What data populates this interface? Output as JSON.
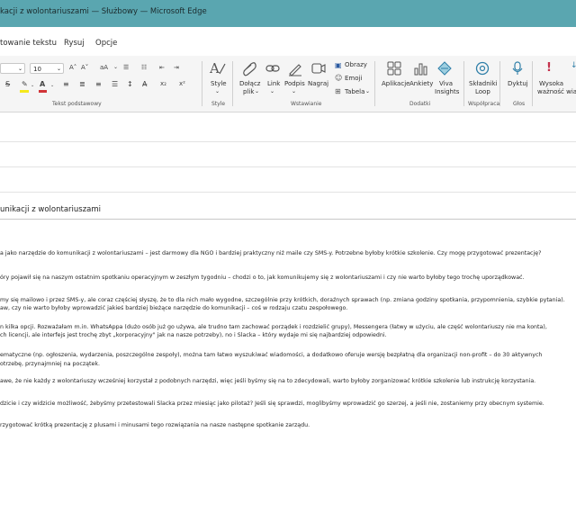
{
  "window": {
    "title": "kacji z wolontariuszami — Służbowy — Microsoft Edge"
  },
  "menu": {
    "items": [
      "towanie tekstu",
      "Rysuj",
      "Opcje"
    ]
  },
  "ribbon": {
    "font_size": "10",
    "styles_label": "Style",
    "attach_label_1": "Dołącz",
    "attach_label_2": "plik",
    "link_label": "Link",
    "signature_label": "Podpis",
    "record_label": "Nagraj",
    "images_label": "Obrazy",
    "emoji_label": "Emoji",
    "table_label": "Tabela",
    "apps_label": "Aplikacje",
    "polls_label": "Ankiety",
    "viva_label_1": "Viva",
    "viva_label_2": "Insights",
    "loop_label_1": "Składniki",
    "loop_label_2": "Loop",
    "dictate_label": "Dyktuj",
    "priority_label_1": "Wysoka",
    "priority_label_2": "ważność wia",
    "group_basic_text": "Tekst podstawowy",
    "group_style": "Style",
    "group_insert": "Wstawianie",
    "group_addins": "Dodatki",
    "group_collab": "Współpraca",
    "group_voice": "Głos",
    "accent": "#5aa6b0"
  },
  "message": {
    "subject": "unikacji z wolontariuszami",
    "paragraphs": [
      "a jako narzędzie do komunikacji z wolontariuszami – jest darmowy dla NGO i bardziej praktyczny niż maile czy SMS-y. Potrzebne byłoby krótkie szkolenie. Czy mogę przygotować prezentację?",
      "óry pojawił się na naszym ostatnim spotkaniu operacyjnym w zeszłym tygodniu – chodzi o to, jak komunikujemy się z wolontariuszami i czy nie warto byłoby tego trochę uporządkować.",
      "my się mailowo i przez SMS-y, ale coraz częściej słyszę, że to dla nich mało wygodne, szczególnie przy krótkich, doraźnych sprawach (np. zmiana godziny spotkania, przypomnienia, szybkie pytania).",
      "aw, czy nie warto byłoby wprowadzić jakieś bardziej bieżące narzędzie do komunikacji – coś w rodzaju czatu zespołowego.",
      "n kilka opcji. Rozważałam m.in. WhatsAppa (dużo osób już go używa, ale trudno tam zachować porządek i rozdzielić grupy), Messengera (łatwy w użyciu, ale część wolontariuszy nie ma konta),",
      "ch licencji, ale interfejs jest trochę zbyt „korporacyjny\" jak na nasze potrzeby), no i Slacka – który wydaje mi się najbardziej odpowiedni.",
      "ematyczne (np. ogłoszenia, wydarzenia, poszczególne zespoły), można tam łatwo wyszukiwać wiadomości, a dodatkowo oferuje wersję bezpłatną dla organizacji non-profit – do 30 aktywnych",
      "otrzebę, przynajmniej na początek.",
      "awe, że nie każdy z wolontariuszy wcześniej korzystał z podobnych narzędzi, więc jeśli byśmy się na to zdecydowali, warto byłoby zorganizować krótkie szkolenie lub instrukcję korzystania.",
      "dzicie i czy widzicie możliwość, żebyśmy przetestowali Slacka przez miesiąc jako pilotaż? Jeśli się sprawdzi, moglibyśmy wprowadzić go szerzej, a jeśli nie, zostaniemy przy obecnym systemie.",
      "rzygotować krótką prezentację z plusami i minusami tego rozwiązania na nasze następne spotkanie zarządu."
    ]
  }
}
